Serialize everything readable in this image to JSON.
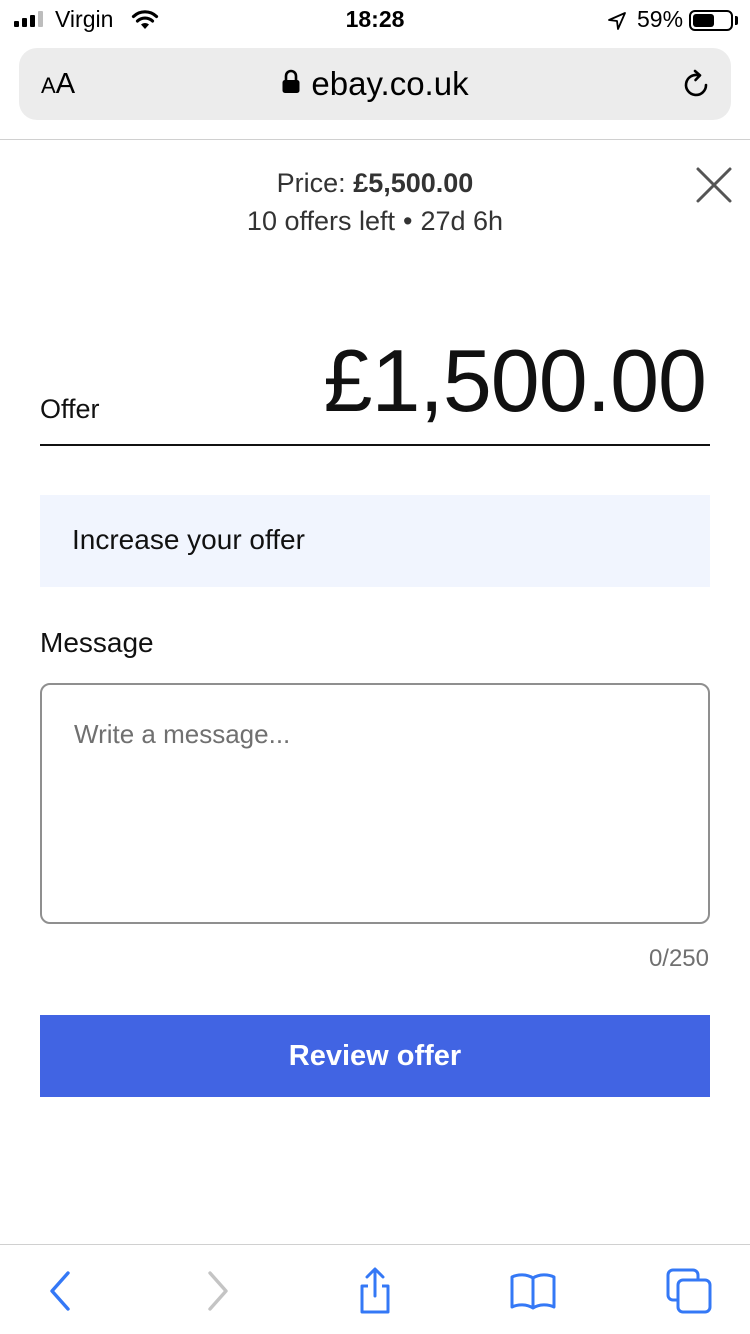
{
  "status_bar": {
    "carrier": "Virgin",
    "time": "18:28",
    "battery_percent": "59%",
    "battery_level": 0.59,
    "icons": [
      "signal-icon",
      "wifi-icon",
      "location-icon",
      "battery-icon"
    ]
  },
  "browser": {
    "text_size_label_small": "A",
    "text_size_label_big": "A",
    "url": "ebay.co.uk",
    "icons": [
      "lock-icon",
      "reload-icon"
    ]
  },
  "header": {
    "price_label": "Price:",
    "price_value": "£5,500.00",
    "offers_left": "10 offers left",
    "separator": "•",
    "time_left": "27d 6h",
    "icons": [
      "close-icon"
    ]
  },
  "offer": {
    "label": "Offer",
    "amount": "£1,500.00"
  },
  "increase": {
    "text": "Increase your offer"
  },
  "message": {
    "label": "Message",
    "placeholder": "Write a message...",
    "value": "",
    "char_count": "0/250"
  },
  "review_button": {
    "label": "Review offer",
    "color": "#4164e3"
  },
  "toolbar": {
    "icons": [
      "back-icon",
      "forward-icon",
      "share-icon",
      "bookmarks-icon",
      "tabs-icon"
    ],
    "accent_color": "#3478f6"
  }
}
